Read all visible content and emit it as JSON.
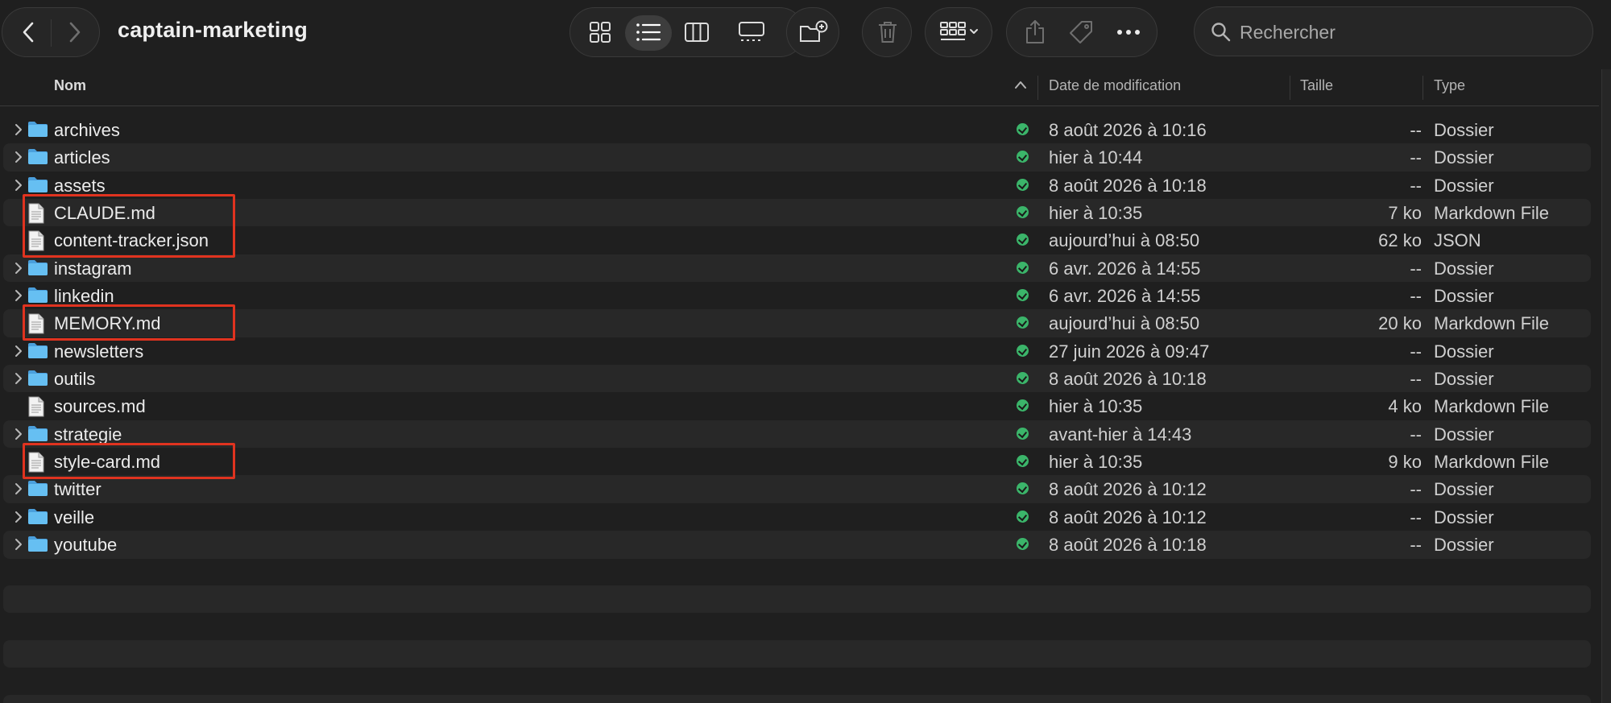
{
  "window": {
    "title": "captain-marketing"
  },
  "search": {
    "placeholder": "Rechercher"
  },
  "columns": {
    "name": "Nom",
    "date": "Date de modification",
    "size": "Taille",
    "kind": "Type"
  },
  "files": [
    {
      "name": "archives",
      "is_folder": true,
      "date": "8 août 2026 à 10:16",
      "size": "--",
      "kind": "Dossier",
      "highlighted": false
    },
    {
      "name": "articles",
      "is_folder": true,
      "date": "hier à 10:44",
      "size": "--",
      "kind": "Dossier",
      "highlighted": false
    },
    {
      "name": "assets",
      "is_folder": true,
      "date": "8 août 2026 à 10:18",
      "size": "--",
      "kind": "Dossier",
      "highlighted": false
    },
    {
      "name": "CLAUDE.md",
      "is_folder": false,
      "date": "hier à 10:35",
      "size": "7 ko",
      "kind": "Markdown File",
      "highlighted": true
    },
    {
      "name": "content-tracker.json",
      "is_folder": false,
      "date": "aujourd’hui à 08:50",
      "size": "62 ko",
      "kind": "JSON",
      "highlighted": true
    },
    {
      "name": "instagram",
      "is_folder": true,
      "date": "6 avr. 2026 à 14:55",
      "size": "--",
      "kind": "Dossier",
      "highlighted": false
    },
    {
      "name": "linkedin",
      "is_folder": true,
      "date": "6 avr. 2026 à 14:55",
      "size": "--",
      "kind": "Dossier",
      "highlighted": false
    },
    {
      "name": "MEMORY.md",
      "is_folder": false,
      "date": "aujourd’hui à 08:50",
      "size": "20 ko",
      "kind": "Markdown File",
      "highlighted": true
    },
    {
      "name": "newsletters",
      "is_folder": true,
      "date": "27 juin 2026 à 09:47",
      "size": "--",
      "kind": "Dossier",
      "highlighted": false
    },
    {
      "name": "outils",
      "is_folder": true,
      "date": "8 août 2026 à 10:18",
      "size": "--",
      "kind": "Dossier",
      "highlighted": false
    },
    {
      "name": "sources.md",
      "is_folder": false,
      "date": "hier à 10:35",
      "size": "4 ko",
      "kind": "Markdown File",
      "highlighted": false
    },
    {
      "name": "strategie",
      "is_folder": true,
      "date": "avant-hier à 14:43",
      "size": "--",
      "kind": "Dossier",
      "highlighted": false
    },
    {
      "name": "style-card.md",
      "is_folder": false,
      "date": "hier à 10:35",
      "size": "9 ko",
      "kind": "Markdown File",
      "highlighted": true
    },
    {
      "name": "twitter",
      "is_folder": true,
      "date": "8 août 2026 à 10:12",
      "size": "--",
      "kind": "Dossier",
      "highlighted": false
    },
    {
      "name": "veille",
      "is_folder": true,
      "date": "8 août 2026 à 10:12",
      "size": "--",
      "kind": "Dossier",
      "highlighted": false
    },
    {
      "name": "youtube",
      "is_folder": true,
      "date": "8 août 2026 à 10:18",
      "size": "--",
      "kind": "Dossier",
      "highlighted": false
    }
  ],
  "toolbar_icons": [
    "back-icon",
    "forward-icon",
    "grid-view-icon",
    "list-view-icon",
    "column-view-icon",
    "gallery-view-icon",
    "new-folder-icon",
    "trash-icon",
    "group-icon",
    "share-icon",
    "tag-icon",
    "more-icon",
    "search-icon"
  ],
  "colors": {
    "folder": "#5ab0e8",
    "sync": "#3bb56a",
    "highlight": "#e0331f",
    "background": "#1f1f1f"
  },
  "selected_view": "list"
}
